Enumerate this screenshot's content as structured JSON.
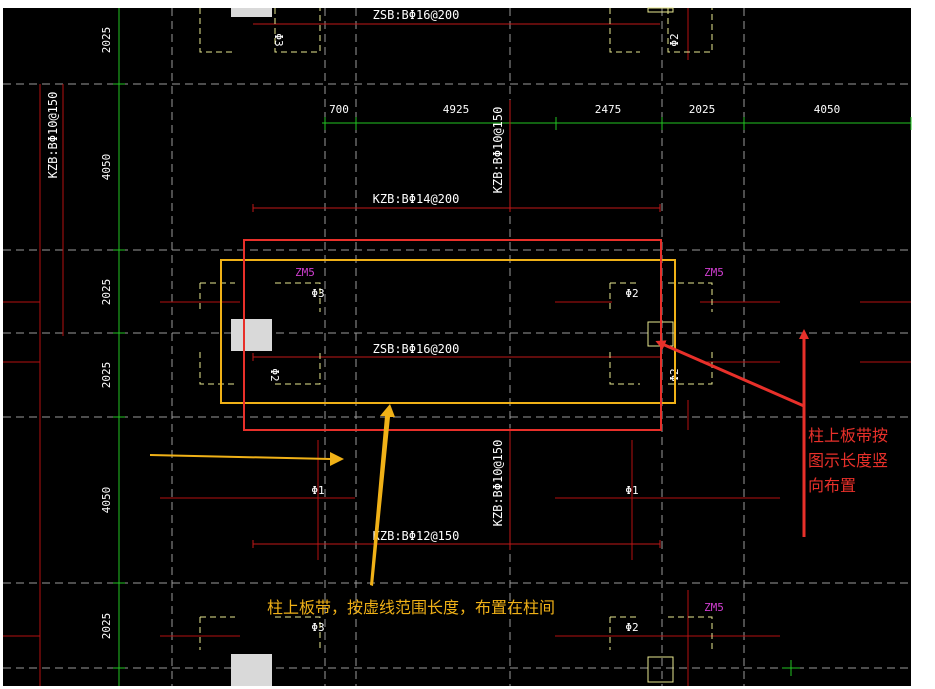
{
  "colors": {
    "background": "#000000",
    "page_margin": "#ffffff",
    "axis_line": "#c0c0c0",
    "beam_line": "#c00000",
    "dimension_line": "#22c322",
    "rebar_line": "#e5e58a",
    "column_fill": "#d9d9d9",
    "band_label": "#d23fd2",
    "red_annotation": "#e8302a",
    "orange_annotation": "#f0b117"
  },
  "top_dimensions": {
    "values": [
      "700",
      "4925",
      "2475",
      "2025",
      "4050"
    ]
  },
  "left_dimensions": {
    "values": [
      "2025",
      "4050",
      "2025",
      "2025",
      "4050",
      "2025"
    ]
  },
  "rebar_labels": {
    "zsb_top": "ZSB:BΦ16@200",
    "kzb_upper": "KZB:BΦ14@200",
    "kzb_vertical_upper": "KZB:BΦ10@150",
    "zsb_middle": "ZSB:BΦ16@200",
    "kzb_vertical_left": "KZB:BΦ10@150",
    "kzb_vertical_lower": "KZB:BΦ10@150",
    "kzb_lower": "KZB:BΦ12@150"
  },
  "bar_marks": {
    "phi1": "Φ1",
    "phi2": "Φ2",
    "phi3": "Φ3"
  },
  "band_labels": {
    "zm": "ZM5"
  },
  "annotations": {
    "red_note_line1": "柱上板带按",
    "red_note_line2": "图示长度竖",
    "red_note_line3": "向布置",
    "orange_note": "柱上板带，按虚线范围长度，布置在柱间"
  }
}
